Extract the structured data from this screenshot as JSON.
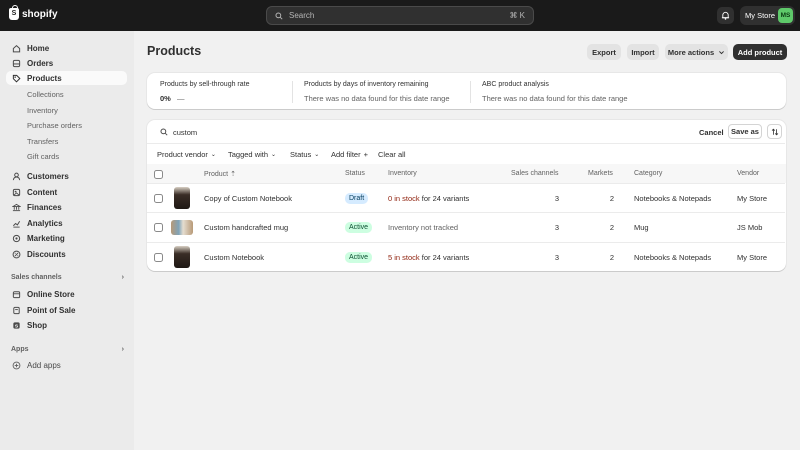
{
  "topbar": {
    "logo_text": "shopify",
    "search_placeholder": "Search",
    "search_shortcut": "⌘ K",
    "store_name": "My Store",
    "avatar_initials": "MS",
    "avatar_color": "#5ec96a"
  },
  "sidebar": {
    "items": [
      {
        "label": "Home",
        "icon": "home-icon"
      },
      {
        "label": "Orders",
        "icon": "orders-icon"
      },
      {
        "label": "Products",
        "icon": "tag-icon",
        "active": true
      },
      {
        "label": "Customers",
        "icon": "person-icon"
      },
      {
        "label": "Content",
        "icon": "content-icon"
      },
      {
        "label": "Finances",
        "icon": "bank-icon"
      },
      {
        "label": "Analytics",
        "icon": "chart-icon"
      },
      {
        "label": "Marketing",
        "icon": "target-icon"
      },
      {
        "label": "Discounts",
        "icon": "discount-icon"
      }
    ],
    "product_subitems": [
      "Collections",
      "Inventory",
      "Purchase orders",
      "Transfers",
      "Gift cards"
    ],
    "sales_channels_label": "Sales channels",
    "sales_channels": [
      {
        "label": "Online Store",
        "icon": "store-icon"
      },
      {
        "label": "Point of Sale",
        "icon": "pos-icon"
      },
      {
        "label": "Shop",
        "icon": "shop-icon"
      }
    ],
    "apps_label": "Apps",
    "add_apps_label": "Add apps"
  },
  "page": {
    "title": "Products",
    "export_label": "Export",
    "import_label": "Import",
    "more_actions_label": "More actions",
    "add_product_label": "Add product"
  },
  "metrics": [
    {
      "title": "Products by sell-through rate",
      "value": "0%",
      "delta": "—"
    },
    {
      "title": "Products by days of inventory remaining",
      "value": "There was no data found for this date range"
    },
    {
      "title": "ABC product analysis",
      "value": "There was no data found for this date range"
    }
  ],
  "filter": {
    "query": "custom",
    "cancel_label": "Cancel",
    "save_as_label": "Save as",
    "chips": [
      "Product vendor",
      "Tagged with",
      "Status",
      "Add filter",
      "Clear all"
    ]
  },
  "table": {
    "headers": {
      "product": "Product",
      "status": "Status",
      "inventory": "Inventory",
      "sales_channels": "Sales channels",
      "markets": "Markets",
      "category": "Category",
      "vendor": "Vendor"
    },
    "rows": [
      {
        "name": "Copy of Custom Notebook",
        "status": "Draft",
        "inventory_highlight": "0 in stock",
        "inventory_rest": " for 24 variants",
        "sales_channels": "3",
        "markets": "2",
        "category": "Notebooks & Notepads",
        "vendor": "My Store"
      },
      {
        "name": "Custom handcrafted mug",
        "status": "Active",
        "inventory_highlight": "",
        "inventory_rest": "Inventory not tracked",
        "sales_channels": "3",
        "markets": "2",
        "category": "Mug",
        "vendor": "JS Mob"
      },
      {
        "name": "Custom Notebook",
        "status": "Active",
        "inventory_highlight": "5 in stock",
        "inventory_rest": " for 24 variants",
        "sales_channels": "3",
        "markets": "2",
        "category": "Notebooks & Notepads",
        "vendor": "My Store"
      }
    ]
  }
}
